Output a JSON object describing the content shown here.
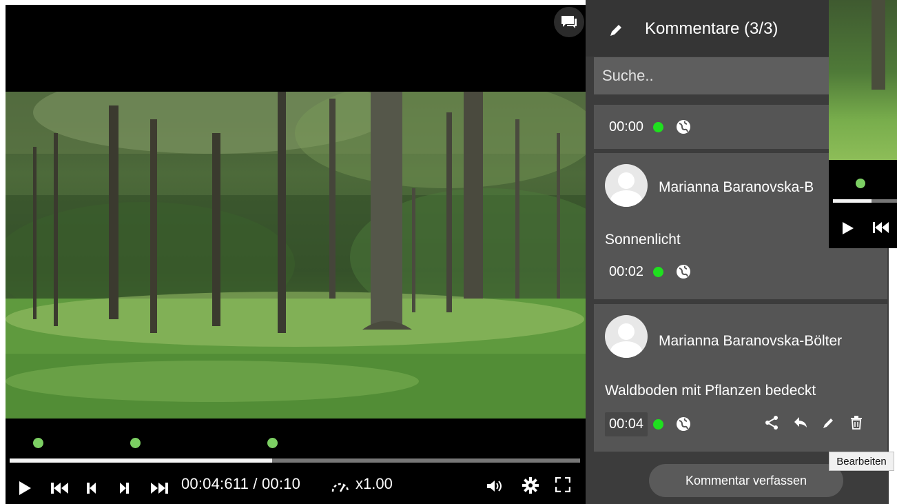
{
  "player": {
    "time_display": "00:04:611 / 00:10",
    "speed": "x1.00",
    "progress_fraction": 0.46
  },
  "comments_panel": {
    "title": "Kommentare (3/3)",
    "search_placeholder": "Suche..",
    "comments": [
      {
        "author": "",
        "text": "",
        "timestamp": "00:00"
      },
      {
        "author": "Marianna Baranovska-B",
        "text": "Sonnenlicht",
        "timestamp": "00:02"
      },
      {
        "author": "Marianna Baranovska-Bölter",
        "text": "Waldboden mit Pflanzen bedeckt",
        "timestamp": "00:04"
      }
    ],
    "compose_label": "Kommentar verfassen"
  },
  "tooltip": {
    "text": "Bearbeiten"
  },
  "mini_player": {
    "progress_fraction": 0.6
  },
  "colors": {
    "accent_green": "#1fe01f",
    "marker_green": "#7ccf63",
    "panel_bg": "#3c3c3c",
    "card_bg": "#555555"
  }
}
